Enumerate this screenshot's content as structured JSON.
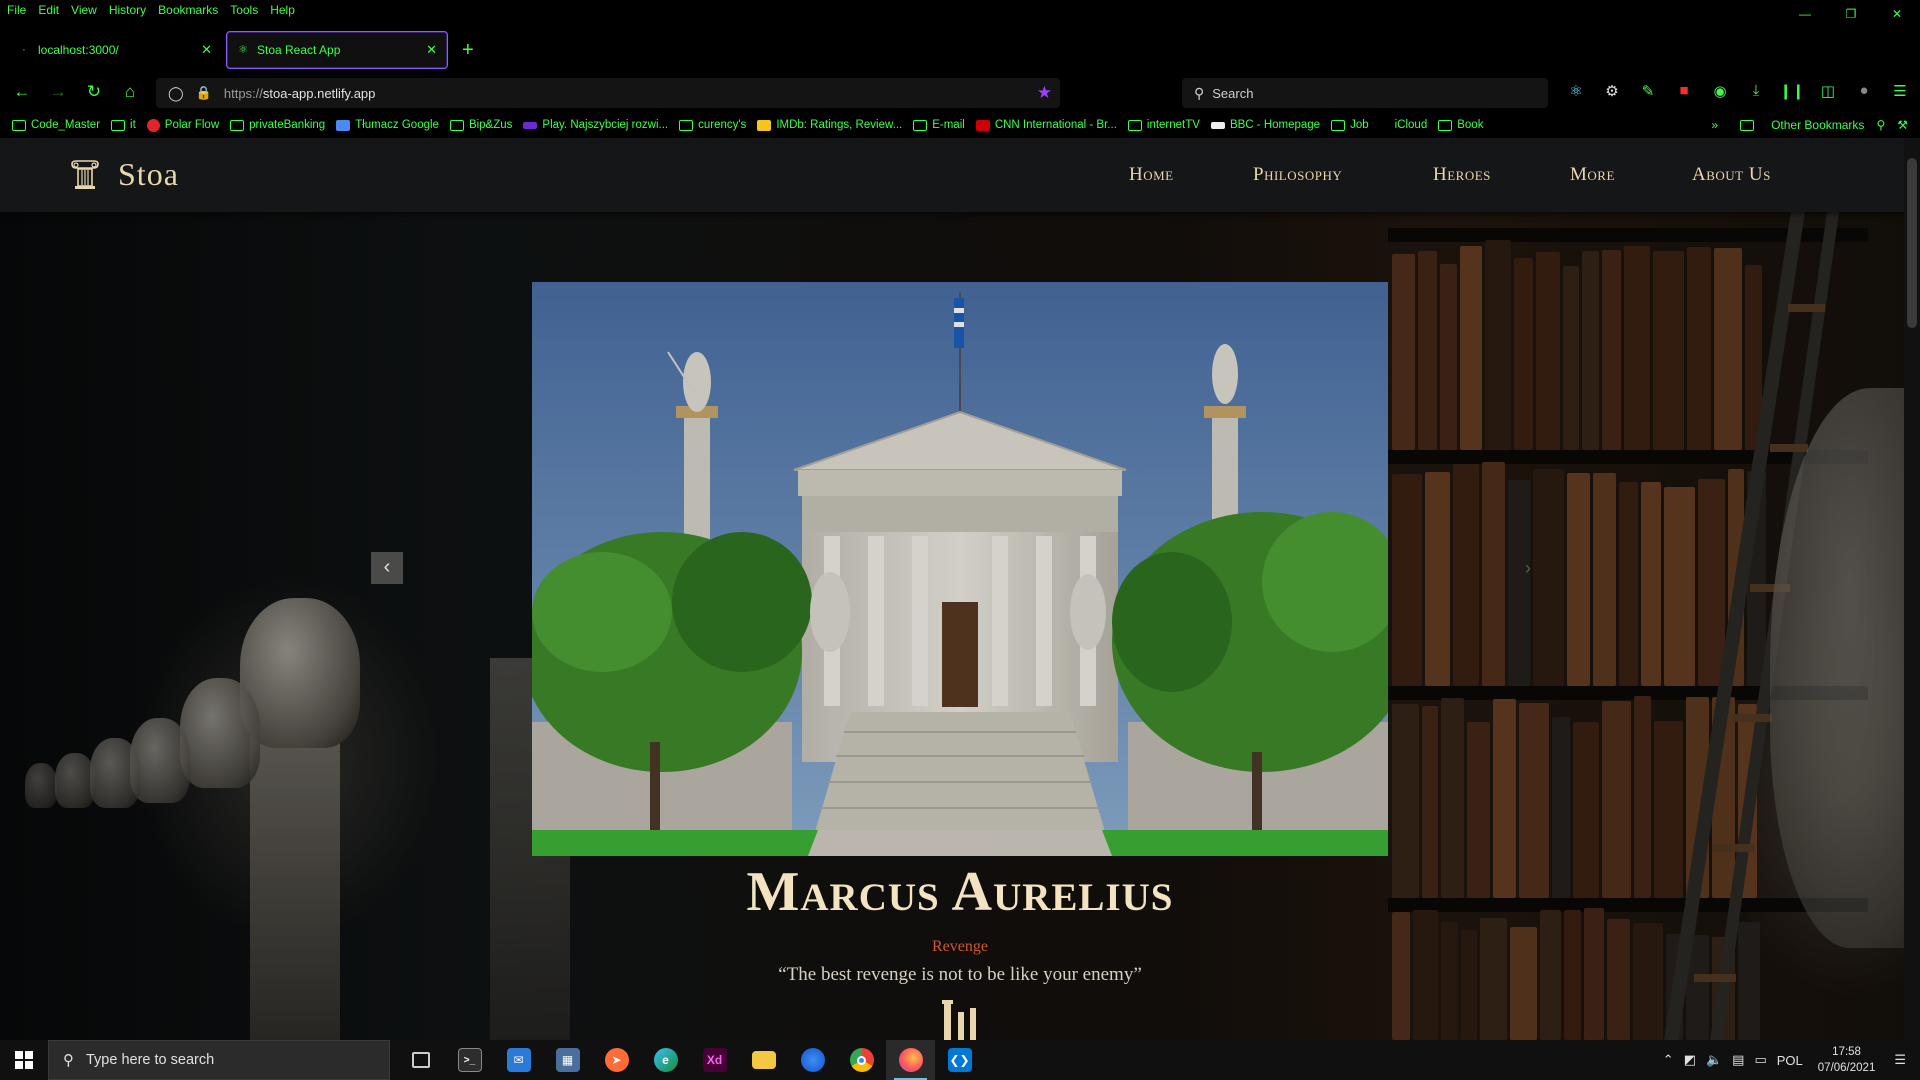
{
  "browser": {
    "menu": [
      "File",
      "Edit",
      "View",
      "History",
      "Bookmarks",
      "Tools",
      "Help"
    ],
    "tabs": [
      {
        "title": "localhost:3000/",
        "active": false
      },
      {
        "title": "Stoa React App",
        "active": true
      }
    ],
    "url_protocol": "https://",
    "url_host": "stoa-app.netlify.app",
    "search_placeholder": "Search",
    "accent_color": "#3dff4a",
    "bookmarks": [
      {
        "label": "Code_Master",
        "icon": "folder-icon"
      },
      {
        "label": "it",
        "icon": "folder-icon"
      },
      {
        "label": "Polar Flow",
        "icon": "polar-icon"
      },
      {
        "label": "privateBanking",
        "icon": "folder-icon"
      },
      {
        "label": "Tłumacz Google",
        "icon": "translate-icon"
      },
      {
        "label": "Bip&Zus",
        "icon": "folder-icon"
      },
      {
        "label": "Play. Najszybciej rozwi...",
        "icon": "play-icon"
      },
      {
        "label": "curency's",
        "icon": "folder-icon"
      },
      {
        "label": "IMDb: Ratings, Review...",
        "icon": "imdb-icon"
      },
      {
        "label": "E-mail",
        "icon": "folder-icon"
      },
      {
        "label": "CNN International - Br...",
        "icon": "cnn-icon"
      },
      {
        "label": "internetTV",
        "icon": "folder-icon"
      },
      {
        "label": "BBC - Homepage",
        "icon": "bbc-icon"
      },
      {
        "label": "Job",
        "icon": "folder-icon"
      },
      {
        "label": "iCloud",
        "icon": "apple-icon"
      },
      {
        "label": "Book",
        "icon": "folder-icon"
      }
    ],
    "other_bookmarks": "Other Bookmarks"
  },
  "site": {
    "logo": "Stoa",
    "nav": [
      "Home",
      "Philosophy",
      "Heroes",
      "More",
      "About Us"
    ],
    "hero": {
      "title": "Marcus Aurelius",
      "subtitle": "Revenge",
      "quote": "“The best revenge is not to be like your enemy”"
    }
  },
  "taskbar": {
    "search_placeholder": "Type here to search",
    "apps": [
      "task-view-icon",
      "terminal-icon",
      "mail-icon",
      "calculator-icon",
      "postman-icon",
      "edge-icon",
      "xd-icon",
      "file-explorer-icon",
      "firefox-dev-icon",
      "chrome-icon",
      "firefox-icon",
      "vscode-icon"
    ],
    "language": "POL",
    "time": "17:58",
    "date": "07/06/2021"
  }
}
